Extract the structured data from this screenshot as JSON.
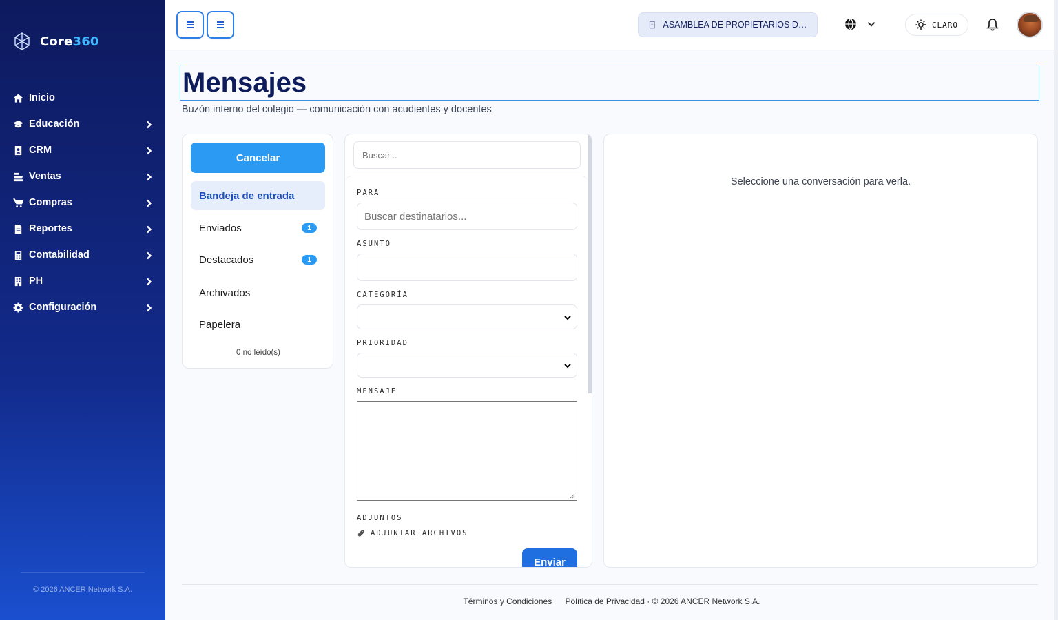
{
  "brand": {
    "name_prefix": "Core",
    "name_suffix": "360"
  },
  "sidebar": {
    "items": [
      {
        "label": "Inicio",
        "icon": "home-icon",
        "expandable": false
      },
      {
        "label": "Educación",
        "icon": "graduation-cap-icon",
        "expandable": true
      },
      {
        "label": "CRM",
        "icon": "contact-book-icon",
        "expandable": true
      },
      {
        "label": "Ventas",
        "icon": "cash-register-icon",
        "expandable": true
      },
      {
        "label": "Compras",
        "icon": "cart-icon",
        "expandable": true
      },
      {
        "label": "Reportes",
        "icon": "file-icon",
        "expandable": true
      },
      {
        "label": "Contabilidad",
        "icon": "calculator-icon",
        "expandable": true
      },
      {
        "label": "PH",
        "icon": "building-icon",
        "expandable": true
      },
      {
        "label": "Configuración",
        "icon": "gear-icon",
        "expandable": true
      }
    ],
    "copyright": "© 2026 ANCER Network S.A."
  },
  "topbar": {
    "organization": "ASAMBLEA DE PROPIETARIOS DE ...",
    "theme_label": "CLARO"
  },
  "header": {
    "title": "Mensajes",
    "subtitle": "Buzón interno del colegio — comunicación con acudientes y docentes"
  },
  "folders": {
    "cancel_label": "Cancelar",
    "items": [
      {
        "label": "Bandeja de entrada",
        "badge": "",
        "active": true
      },
      {
        "label": "Enviados",
        "badge": "1",
        "active": false
      },
      {
        "label": "Destacados",
        "badge": "1",
        "active": false
      },
      {
        "label": "Archivados",
        "badge": "",
        "active": false
      },
      {
        "label": "Papelera",
        "badge": "",
        "active": false
      }
    ],
    "unread_text": "0 no leído(s)"
  },
  "compose": {
    "search_placeholder": "Buscar...",
    "to_label": "PARA",
    "to_placeholder": "Buscar destinatarios...",
    "subject_label": "ASUNTO",
    "subject_value": "",
    "category_label": "CATEGORÍA",
    "category_value": "",
    "priority_label": "PRIORIDAD",
    "priority_value": "",
    "message_label": "MENSAJE",
    "message_value": "",
    "attachments_label": "ADJUNTOS",
    "attach_action": "ADJUNTAR ARCHIVOS",
    "send_label": "Enviar"
  },
  "viewer": {
    "empty_text": "Seleccione una conversación para verla."
  },
  "footer": {
    "terms": "Términos y Condiciones",
    "privacy": "Política de Privacidad",
    "copyright": "· © 2026 ANCER Network S.A."
  },
  "colors": {
    "accent": "#2b9af3",
    "primary": "#1f6fe0",
    "sidebar_top": "#0e1a5e",
    "sidebar_bottom": "#1a4fcf",
    "title": "#0f1c5c"
  }
}
